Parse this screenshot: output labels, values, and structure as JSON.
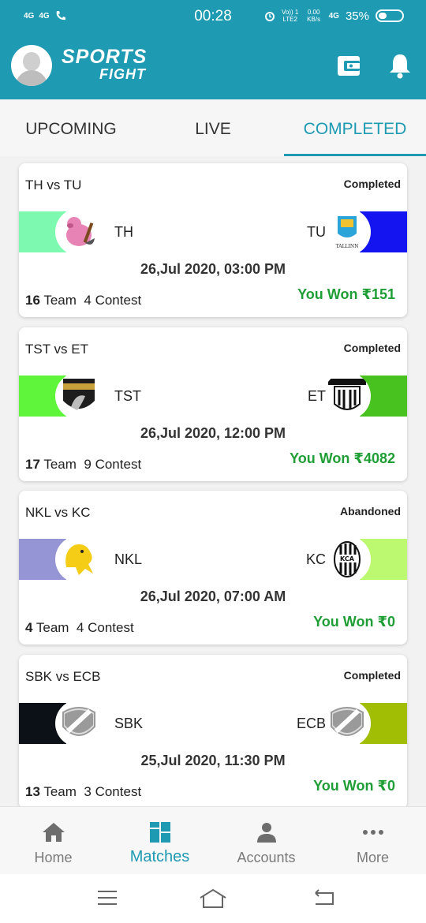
{
  "status_bar": {
    "net1": "4G",
    "net2": "4G",
    "time": "00:28",
    "volte": "Vo)) 1 LTE2",
    "speed": "0.00 KB/s",
    "net3": "4G",
    "battery": "35%"
  },
  "app": {
    "logo_line1": "SPORTS",
    "logo_line2": "FIGHT"
  },
  "tabs": [
    {
      "label": "UPCOMING",
      "active": false
    },
    {
      "label": "LIVE",
      "active": false
    },
    {
      "label": "COMPLETED",
      "active": true
    }
  ],
  "matches": [
    {
      "title": "TH vs TU",
      "status": "Completed",
      "team_left": "TH",
      "team_right": "TU",
      "color_left": "#7dfab0",
      "color_right": "#1414f0",
      "badge_left": "pig-badge-icon",
      "badge_right": "tallinn-badge-icon",
      "date": "26,Jul 2020, 03:00 PM",
      "teams_count": "16",
      "teams_label": "Team",
      "contest_count": "4",
      "contest_label": "Contest",
      "won": "You Won ₹151"
    },
    {
      "title": "TST vs ET",
      "status": "Completed",
      "team_left": "TST",
      "team_right": "ET",
      "color_left": "#5ff53a",
      "color_right": "#47c21f",
      "badge_left": "stallions-badge-icon",
      "badge_right": "tigers-badge-icon",
      "date": "26,Jul 2020, 12:00 PM",
      "teams_count": "17",
      "teams_label": "Team",
      "contest_count": "9",
      "contest_label": "Contest",
      "won": "You Won ₹4082"
    },
    {
      "title": "NKL vs KC",
      "status": "Abandoned",
      "team_left": "NKL",
      "team_right": "KC",
      "color_left": "#9595d6",
      "color_right": "#bdf970",
      "badge_left": "lion-badge-icon",
      "badge_right": "kca-badge-icon",
      "date": "26,Jul 2020, 07:00 AM",
      "teams_count": "4",
      "teams_label": "Team",
      "contest_count": "4",
      "contest_label": "Contest",
      "won": "You Won ₹0"
    },
    {
      "title": "SBK vs ECB",
      "status": "Completed",
      "team_left": "SBK",
      "team_right": "ECB",
      "color_left": "#0c1118",
      "color_right": "#a1bd04",
      "badge_left": "shield-badge-icon",
      "badge_right": "shield-badge-icon",
      "date": "25,Jul 2020, 11:30 PM",
      "teams_count": "13",
      "teams_label": "Team",
      "contest_count": "3",
      "contest_label": "Contest",
      "won": "You Won ₹0"
    }
  ],
  "bottom_nav": [
    {
      "label": "Home",
      "icon": "home-icon",
      "active": false
    },
    {
      "label": "Matches",
      "icon": "grid-icon",
      "active": true
    },
    {
      "label": "Accounts",
      "icon": "person-icon",
      "active": false
    },
    {
      "label": "More",
      "icon": "more-dots-icon",
      "active": false
    }
  ],
  "colors": {
    "brand": "#1e9ab3",
    "won": "#1f9e35"
  }
}
